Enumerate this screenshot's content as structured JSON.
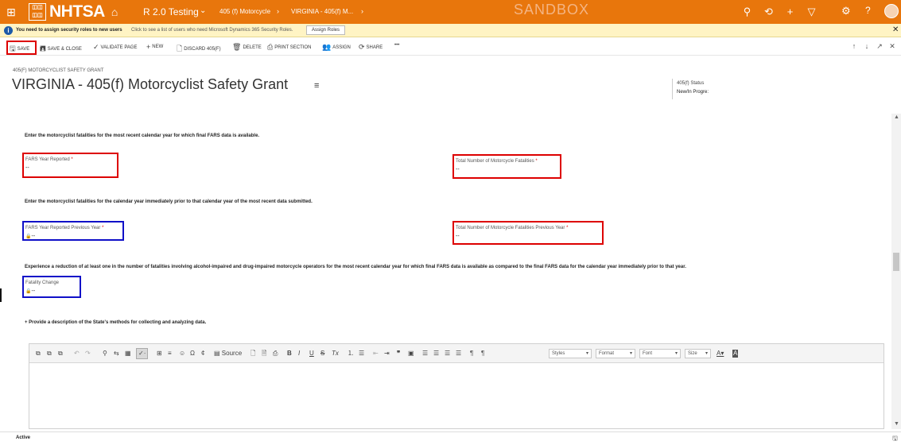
{
  "topnav": {
    "logo_small": "ꕥ ✿ 台 ☗",
    "logo_text": "NHTSA",
    "app_name": "R 2.0 Testing",
    "breadcrumb": [
      "405 (f) Motorcycle",
      "VIRGINIA - 405(f) M..."
    ],
    "environment": "SANDBOX",
    "icons": [
      "search-icon",
      "history-icon",
      "new-icon",
      "filter-icon",
      "settings-icon",
      "help-icon",
      "avatar"
    ]
  },
  "notice": {
    "title": "You need to assign security roles to new users",
    "text": "Click to see a list of users who need Microsoft Dynamics 365 Security Roles.",
    "button": "Assign Roles"
  },
  "commands": {
    "save": "SAVE",
    "save_close": "SAVE & CLOSE",
    "validate": "VALIDATE PAGE",
    "new": "NEW",
    "discard": "DISCARD 405(F)",
    "delete": "DELETE",
    "print": "PRINT SECTION",
    "assign": "ASSIGN",
    "share": "SHARE",
    "more": "•••"
  },
  "header": {
    "record_type": "405(F) MOTORCYCLIST SAFETY GRANT",
    "title": "VIRGINIA - 405(f) Motorcyclist Safety Grant",
    "status_label": "405(f) Status",
    "status_value": "New/In Progre:"
  },
  "form": {
    "instr1": "Enter the motorcyclist fatalities for the most recent calendar year for which final FARS data is available.",
    "instr2": "Enter the motorcyclist fatalities for the calendar year immediately prior to that calendar year of the most recent data submitted.",
    "instr3": "Experience a reduction of at least one in the number of fatalities involving alcohol-impaired and drug-impaired motorcycle operators for the most recent calendar year for which final FARS data is available as compared to the final FARS data for the calendar year immediately prior to that year.",
    "section_toggle": "+ Provide a description of the State's methods for collecting and analyzing data.",
    "fields": {
      "fars_year": {
        "label": "FARS Year Reported",
        "value": "--"
      },
      "total_fatalities": {
        "label": "Total Number of Motorcycle Fatalities",
        "value": "--"
      },
      "fars_year_prev": {
        "label": "FARS Year Reported Previous Year",
        "value": "--"
      },
      "total_fatalities_prev": {
        "label": "Total Number of Motorcycle Fatalities Previous Year",
        "value": "--"
      },
      "fatality_change": {
        "label": "Fatality Change",
        "value": "--"
      }
    },
    "required_mark": "*",
    "lock_glyph": "🔒"
  },
  "editor": {
    "source_label": "Source",
    "styles": "Styles",
    "format": "Format",
    "font": "Font",
    "size": "Size"
  },
  "statusbar": {
    "state": "Active"
  }
}
